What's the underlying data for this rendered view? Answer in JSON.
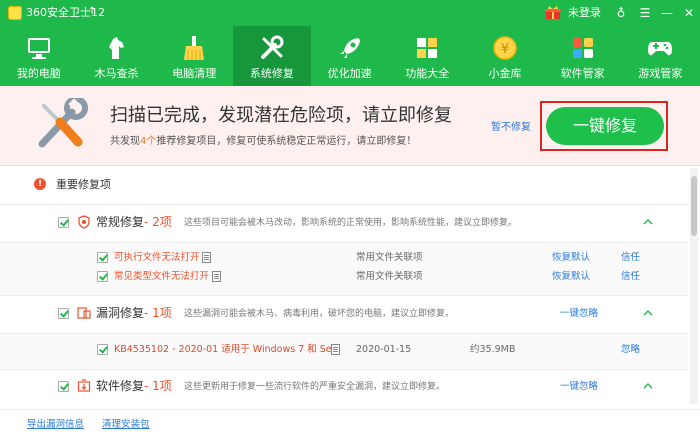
{
  "titlebar": {
    "app_title": "360安全卫士12",
    "up_arrow": "↑",
    "login_label": "未登录",
    "shirt_icon": "♁",
    "menu_icon": "☰",
    "min_icon": "—",
    "close_icon": "✕"
  },
  "nav": {
    "items": [
      {
        "label": "我的电脑",
        "icon": "monitor-icon"
      },
      {
        "label": "木马查杀",
        "icon": "horse-icon"
      },
      {
        "label": "电脑清理",
        "icon": "broom-icon"
      },
      {
        "label": "系统修复",
        "icon": "tools-icon"
      },
      {
        "label": "优化加速",
        "icon": "rocket-icon"
      },
      {
        "label": "功能大全",
        "icon": "grid-icon"
      },
      {
        "label": "小金库",
        "icon": "coin-icon"
      },
      {
        "label": "软件管家",
        "icon": "apps-icon"
      },
      {
        "label": "游戏管家",
        "icon": "gamepad-icon"
      }
    ],
    "active_index": 3
  },
  "banner": {
    "title": "扫描已完成，发现潜在危险项，请立即修复",
    "subtitle_prefix": "共发现",
    "subtitle_count": "4个",
    "subtitle_suffix": "推荐修复项目，修复可使系统稳定正常运行，请立即修复！",
    "pause_link": "暂不修复",
    "fix_button": "一键修复"
  },
  "section": {
    "warn_glyph": "!",
    "title": "重要修复项"
  },
  "categories": [
    {
      "name": "常规修复",
      "count": " - 2项",
      "desc": "这些项目可能会被木马改动，影响系统的正常使用，影响系统性能，建议立即修复。",
      "items": [
        {
          "name": "可执行文件无法打开",
          "type": "常用文件关联项",
          "action1": "恢复默认",
          "action2": "信任"
        },
        {
          "name": "常见类型文件无法打开",
          "type": "常用文件关联项",
          "action1": "恢复默认",
          "action2": "信任"
        }
      ]
    },
    {
      "name": "漏洞修复",
      "count": " - 1项",
      "desc": "这些漏洞可能会被木马、病毒利用，破坏您的电脑，建议立即修复。",
      "action": "一键忽略",
      "items": [
        {
          "name": "KB4535102 - 2020-01 适用于 Windows 7 和 Se...",
          "date": "2020-01-15",
          "size": "约35.9MB",
          "action": "忽略"
        }
      ]
    },
    {
      "name": "软件修复",
      "count": " - 1项",
      "desc": "这些更新用于修复一些流行软件的严重安全漏洞，建议立即修复。",
      "action": "一键忽略"
    }
  ],
  "footer": {
    "link1": "导出漏洞信息",
    "link2": "清理安装包"
  },
  "colors": {
    "header_green": "#1fb84a",
    "active_tab": "#16973b",
    "fix_button": "#1fbf4c",
    "warning_red": "#f0502a",
    "link_blue": "#2b7ad9",
    "highlight_frame": "#d9271f"
  }
}
